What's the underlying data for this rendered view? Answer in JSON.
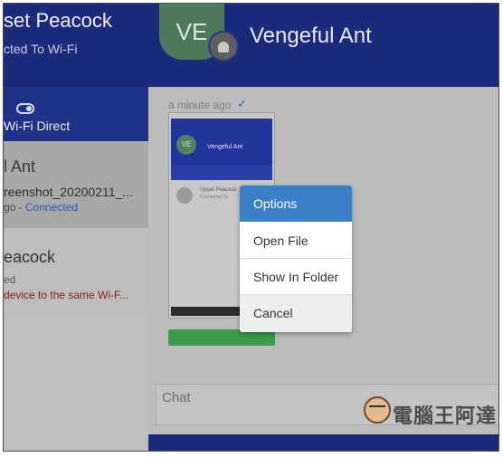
{
  "left_panel": {
    "title": "set Peacock",
    "subtitle": "cted To Wi-Fi",
    "wifi_direct_label": "Wi-Fi Direct",
    "devices": [
      {
        "name": "l Ant",
        "file": "reenshot_20200211_...",
        "status_prefix": "go - ",
        "status_connected": "Connected"
      },
      {
        "name": "eacock",
        "status": "ed",
        "error": "device to the same Wi-F..."
      }
    ]
  },
  "header": {
    "avatar_initials": "VE",
    "peer_name": "Vengeful Ant"
  },
  "chat": {
    "timestamp": "a minute ago",
    "check_glyph": "✓",
    "input_placeholder": "Chat"
  },
  "thumbnail": {
    "avatar_initials": "VE",
    "header_name": "Vengeful Ant",
    "item_name": "Upset Peacock",
    "item_status": "Connected To"
  },
  "context_menu": {
    "items": [
      {
        "label": "Options"
      },
      {
        "label": "Open File"
      },
      {
        "label": "Show In Folder"
      },
      {
        "label": "Cancel"
      }
    ]
  },
  "watermark": {
    "text": "電腦王阿達"
  },
  "colors": {
    "header_blue": "#1b2a7a",
    "menu_highlight": "#3a80c6",
    "connected_link": "#2a55c8",
    "error_text": "#8a1a1a",
    "open_button": "#3c9a4b"
  },
  "icons": [
    "toggle-icon",
    "android-icon",
    "check-icon"
  ]
}
